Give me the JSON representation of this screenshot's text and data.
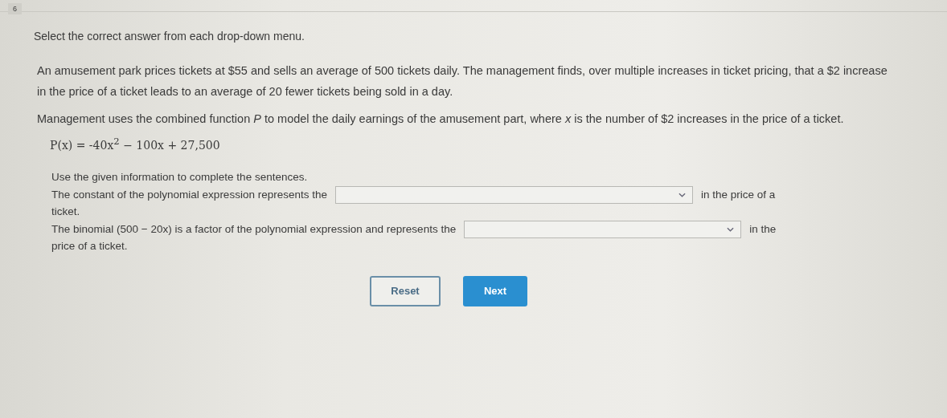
{
  "question_number": "6",
  "instruction": "Select the correct answer from each drop-down menu.",
  "paragraphs": [
    "An amusement park prices tickets at $55 and sells an average of 500 tickets daily. The management finds, over multiple increases in ticket pricing, that a $2 increase in the price of a ticket leads to an average of 20 fewer tickets being sold in a day.",
    "Management uses the combined function *P* to model the daily earnings of the amusement part, where *x* is the number of $2 increases in the price of a ticket."
  ],
  "formula": "P(x) = -40x$^{2}$ − 100x + 27,500",
  "prompt": "Use the given information to complete the sentences.",
  "sentences": [
    {
      "before": "The constant of the polynomial expression represents the",
      "after": "in the price of a",
      "after_line2": "ticket."
    },
    {
      "before": "The binomial (500 − 20x) is a factor of the polynomial expression and represents the",
      "after": "in the",
      "after_line2": "price of a ticket."
    }
  ],
  "buttons": [
    {
      "label": "Reset",
      "kind": "secondary"
    },
    {
      "label": "Next",
      "kind": "primary"
    }
  ]
}
